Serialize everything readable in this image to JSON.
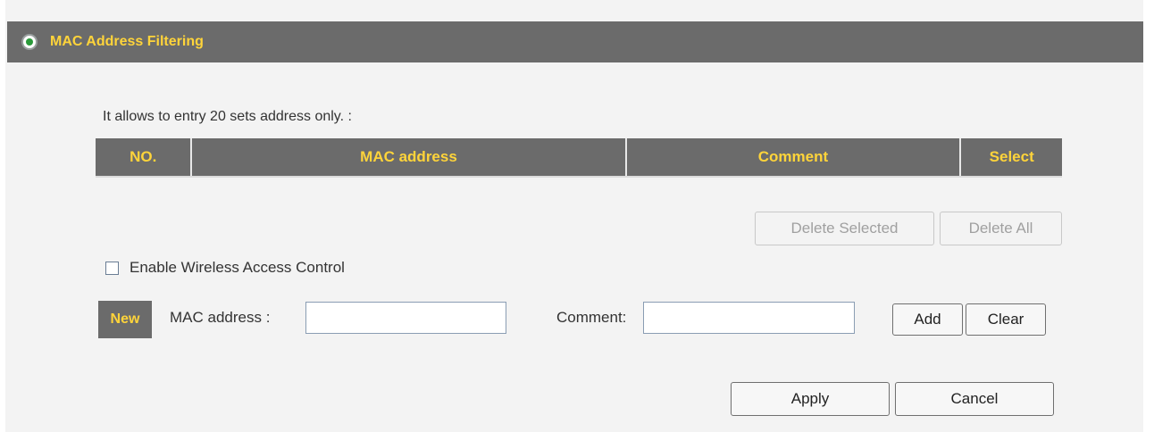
{
  "header": {
    "title": "MAC Address Filtering",
    "icon": "radio-on-icon"
  },
  "info_text": "It allows to entry 20 sets address only. :",
  "table": {
    "columns": [
      "NO.",
      "MAC address",
      "Comment",
      "Select"
    ],
    "rows": []
  },
  "actions": {
    "delete_selected": "Delete Selected",
    "delete_all": "Delete All"
  },
  "access_control": {
    "label": "Enable Wireless Access Control",
    "checked": false
  },
  "new_entry": {
    "badge": "New",
    "mac_label": "MAC address :",
    "mac_value": "",
    "comment_label": "Comment:",
    "comment_value": "",
    "add": "Add",
    "clear": "Clear"
  },
  "footer": {
    "apply": "Apply",
    "cancel": "Cancel"
  },
  "colors": {
    "header_bg": "#6b6b6b",
    "header_text": "#ffd43a"
  }
}
